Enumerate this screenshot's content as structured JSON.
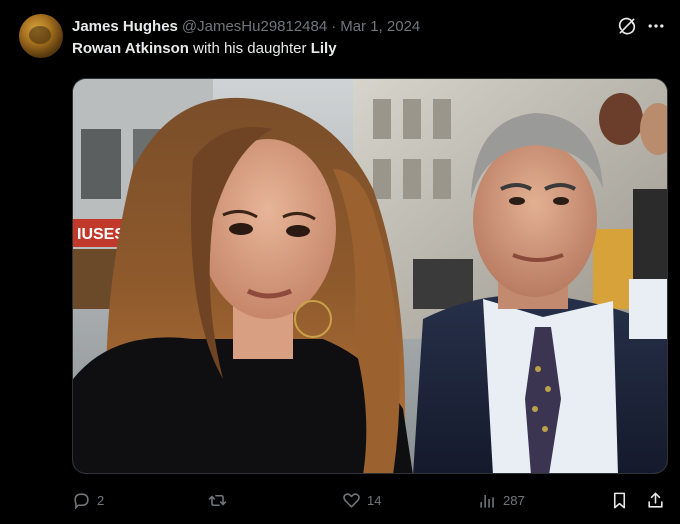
{
  "post": {
    "author_name": "James Hughes",
    "author_handle": "@JamesHu29812484",
    "separator": "·",
    "date": "Mar 1, 2024",
    "text_prefix": "Rowan Atkinson",
    "text_middle": " with his daughter ",
    "text_suffix": "Lily"
  },
  "media": {
    "sign_text": "IUSES"
  },
  "actions": {
    "replies": "2",
    "reposts": "",
    "likes": "14",
    "views": "287"
  },
  "icons": {
    "avatar": "avatar-image",
    "grok": "grok-icon",
    "more": "more-icon",
    "reply": "reply-icon",
    "repost": "repost-icon",
    "like": "heart-icon",
    "views": "views-icon",
    "bookmark": "bookmark-icon",
    "share": "share-icon"
  },
  "colors": {
    "background": "#000000",
    "text": "#e7e9ea",
    "muted": "#71767b"
  }
}
